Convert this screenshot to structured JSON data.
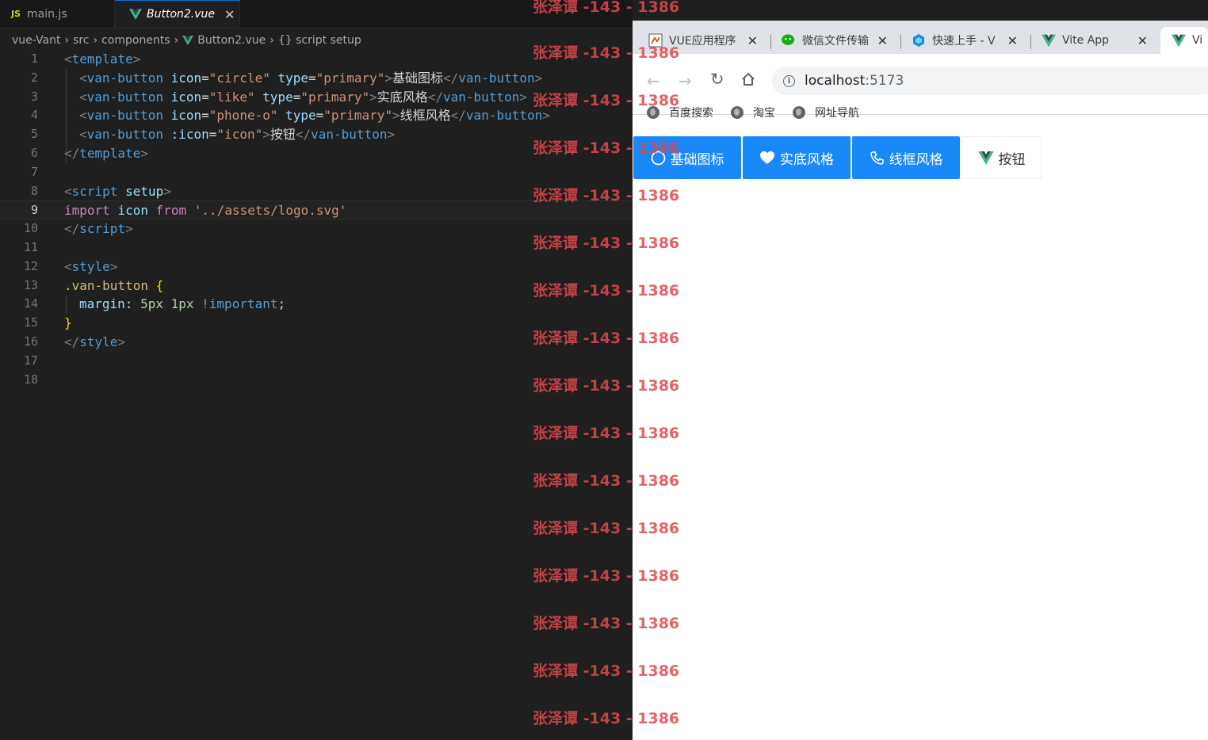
{
  "editor": {
    "tabs": [
      {
        "icon": "JS",
        "label": "main.js"
      },
      {
        "label": "Button2.vue",
        "close": "✕"
      }
    ],
    "breadcrumb": [
      "vue-Vant",
      "src",
      "components",
      "Button2.vue",
      "{} script setup"
    ],
    "line_numbers": [
      "1",
      "2",
      "3",
      "4",
      "5",
      "6",
      "7",
      "8",
      "9",
      "10",
      "11",
      "12",
      "13",
      "14",
      "15",
      "16",
      "17",
      "18"
    ],
    "code": {
      "l1": [
        "<",
        "template",
        ">"
      ],
      "l2": [
        "<",
        "van-button",
        " ",
        "icon",
        "=",
        "\"circle\"",
        " ",
        "type",
        "=",
        "\"primary\"",
        ">",
        "基础图标",
        "</",
        "van-button",
        ">"
      ],
      "l3": [
        "<",
        "van-button",
        " ",
        "icon",
        "=",
        "\"like\"",
        " ",
        "type",
        "=",
        "\"primary\"",
        ">",
        "实底风格",
        "</",
        "van-button",
        ">"
      ],
      "l4": [
        "<",
        "van-button",
        " ",
        "icon",
        "=",
        "\"phone-o\"",
        " ",
        "type",
        "=",
        "\"primary\"",
        ">",
        "线框风格",
        "</",
        "van-button",
        ">"
      ],
      "l5": [
        "<",
        "van-button",
        " ",
        ":icon",
        "=",
        "\"icon\"",
        ">",
        "按钮",
        "</",
        "van-button",
        ">"
      ],
      "l6": [
        "</",
        "template",
        ">"
      ],
      "l8": [
        "<",
        "script",
        " ",
        "setup",
        ">"
      ],
      "l9": [
        "import",
        " ",
        "icon",
        " ",
        "from",
        " ",
        "'../assets/logo.svg'"
      ],
      "l10": [
        "</",
        "script",
        ">"
      ],
      "l12": [
        "<",
        "style",
        ">"
      ],
      "l13": [
        ".van-button",
        " ",
        "{"
      ],
      "l14": [
        "margin",
        ": ",
        "5px",
        " ",
        "1px",
        " ",
        "!important",
        ";"
      ],
      "l15": [
        "}"
      ],
      "l16": [
        "</",
        "style",
        ">"
      ]
    }
  },
  "watermark": "张泽谭 -143 - 1386",
  "browser": {
    "tabs": [
      {
        "label": "VUE应用程序",
        "close": "✕"
      },
      {
        "label": "微信文件传输",
        "close": "✕"
      },
      {
        "label": "快速上手 - V",
        "close": "✕"
      },
      {
        "label": "Vite App",
        "close": "✕"
      },
      {
        "label": "Vi"
      }
    ],
    "url": {
      "host": "localhost",
      "port": ":5173"
    },
    "bookmarks": [
      "百度搜索",
      "淘宝",
      "网址导航"
    ],
    "buttons": [
      {
        "label": "基础图标",
        "icon": "circle-icon",
        "type": "primary"
      },
      {
        "label": "实底风格",
        "icon": "heart-icon",
        "type": "primary"
      },
      {
        "label": "线框风格",
        "icon": "phone-icon",
        "type": "primary"
      },
      {
        "label": "按钮",
        "icon": "vue-logo-icon",
        "type": "default"
      }
    ],
    "colors": {
      "primary": "#1989fa",
      "tab_bar": "#dfe3e8"
    }
  }
}
